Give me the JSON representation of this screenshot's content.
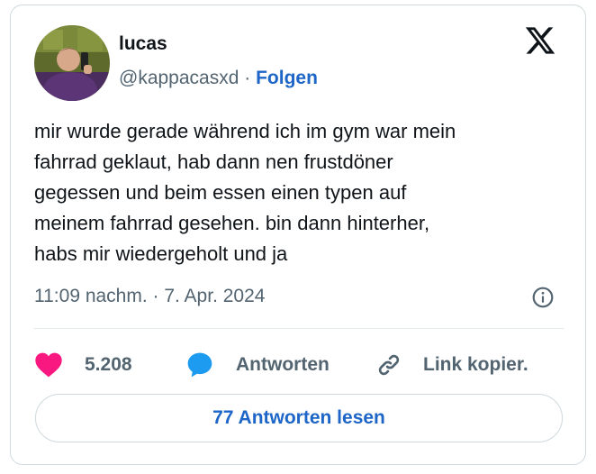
{
  "user": {
    "name": "lucas",
    "handle": "@kappacasxd",
    "separator": "·",
    "follow_label": "Folgen"
  },
  "tweet": {
    "lines": [
      "mir wurde gerade während ich im gym war mein",
      "fahrrad geklaut, hab dann nen frustdöner",
      "gegessen und beim essen einen typen auf",
      "meinem fahrrad gesehen. bin dann hinterher,",
      "habs mir wiedergeholt und ja"
    ],
    "timestamp": "11:09 nachm. · 7. Apr. 2024"
  },
  "actions": {
    "like_count": "5.208",
    "reply_label": "Antworten",
    "copy_link_label": "Link kopier."
  },
  "read_replies_label": "77 Antworten lesen",
  "icons": {
    "brand": "x-logo-icon",
    "info": "info-icon",
    "like": "heart-icon",
    "reply": "speech-bubble-icon",
    "link": "link-icon"
  },
  "colors": {
    "link_blue": "#1d66c7",
    "heart_pink": "#f91880",
    "reply_blue": "#1d9bf0",
    "secondary_text": "#536471"
  }
}
